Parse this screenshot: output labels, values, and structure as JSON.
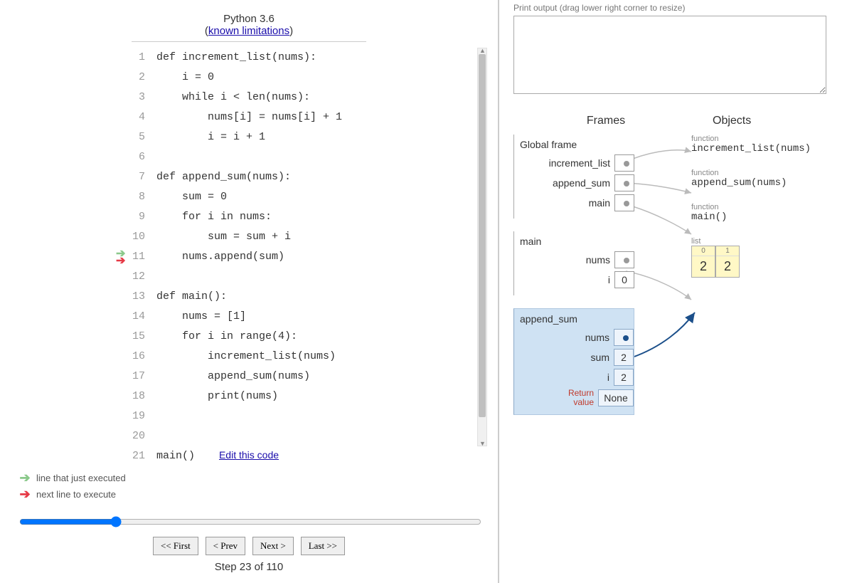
{
  "header": {
    "language": "Python 3.6",
    "limitations_label": "known limitations"
  },
  "code": {
    "lines": [
      "def increment_list(nums):",
      "    i = 0",
      "    while i < len(nums):",
      "        nums[i] = nums[i] + 1",
      "        i = i + 1",
      "",
      "def append_sum(nums):",
      "    sum = 0",
      "    for i in nums:",
      "        sum = sum + i",
      "    nums.append(sum)",
      "",
      "def main():",
      "    nums = [1]",
      "    for i in range(4):",
      "        increment_list(nums)",
      "        append_sum(nums)",
      "        print(nums)",
      "",
      "",
      "main()"
    ],
    "just_executed_line": 11,
    "next_line": 11,
    "edit_label": "Edit this code"
  },
  "legend": {
    "just_executed": "line that just executed",
    "next": "next line to execute"
  },
  "controls": {
    "first": "<< First",
    "prev": "< Prev",
    "next": "Next >",
    "last": "Last >>",
    "step_label": "Step 23 of 110",
    "slider_value": 23,
    "slider_max": 110
  },
  "output": {
    "label": "Print output (drag lower right corner to resize)",
    "value": ""
  },
  "viz": {
    "frames_header": "Frames",
    "objects_header": "Objects",
    "global_frame": {
      "title": "Global frame",
      "vars": [
        "increment_list",
        "append_sum",
        "main"
      ]
    },
    "main_frame": {
      "title": "main",
      "vars": [
        {
          "name": "nums",
          "value": ""
        },
        {
          "name": "i",
          "value": "0"
        }
      ]
    },
    "append_sum_frame": {
      "title": "append_sum",
      "vars": [
        {
          "name": "nums",
          "value": ""
        },
        {
          "name": "sum",
          "value": "2"
        },
        {
          "name": "i",
          "value": "2"
        }
      ],
      "return_label": "Return\nvalue",
      "return_value": "None"
    },
    "objects": {
      "increment_list": {
        "kind": "function",
        "signature": "increment_list(nums)"
      },
      "append_sum": {
        "kind": "function",
        "signature": "append_sum(nums)"
      },
      "main": {
        "kind": "function",
        "signature": "main()"
      },
      "list": {
        "kind": "list",
        "indices": [
          "0",
          "1"
        ],
        "values": [
          "2",
          "2"
        ]
      }
    }
  }
}
